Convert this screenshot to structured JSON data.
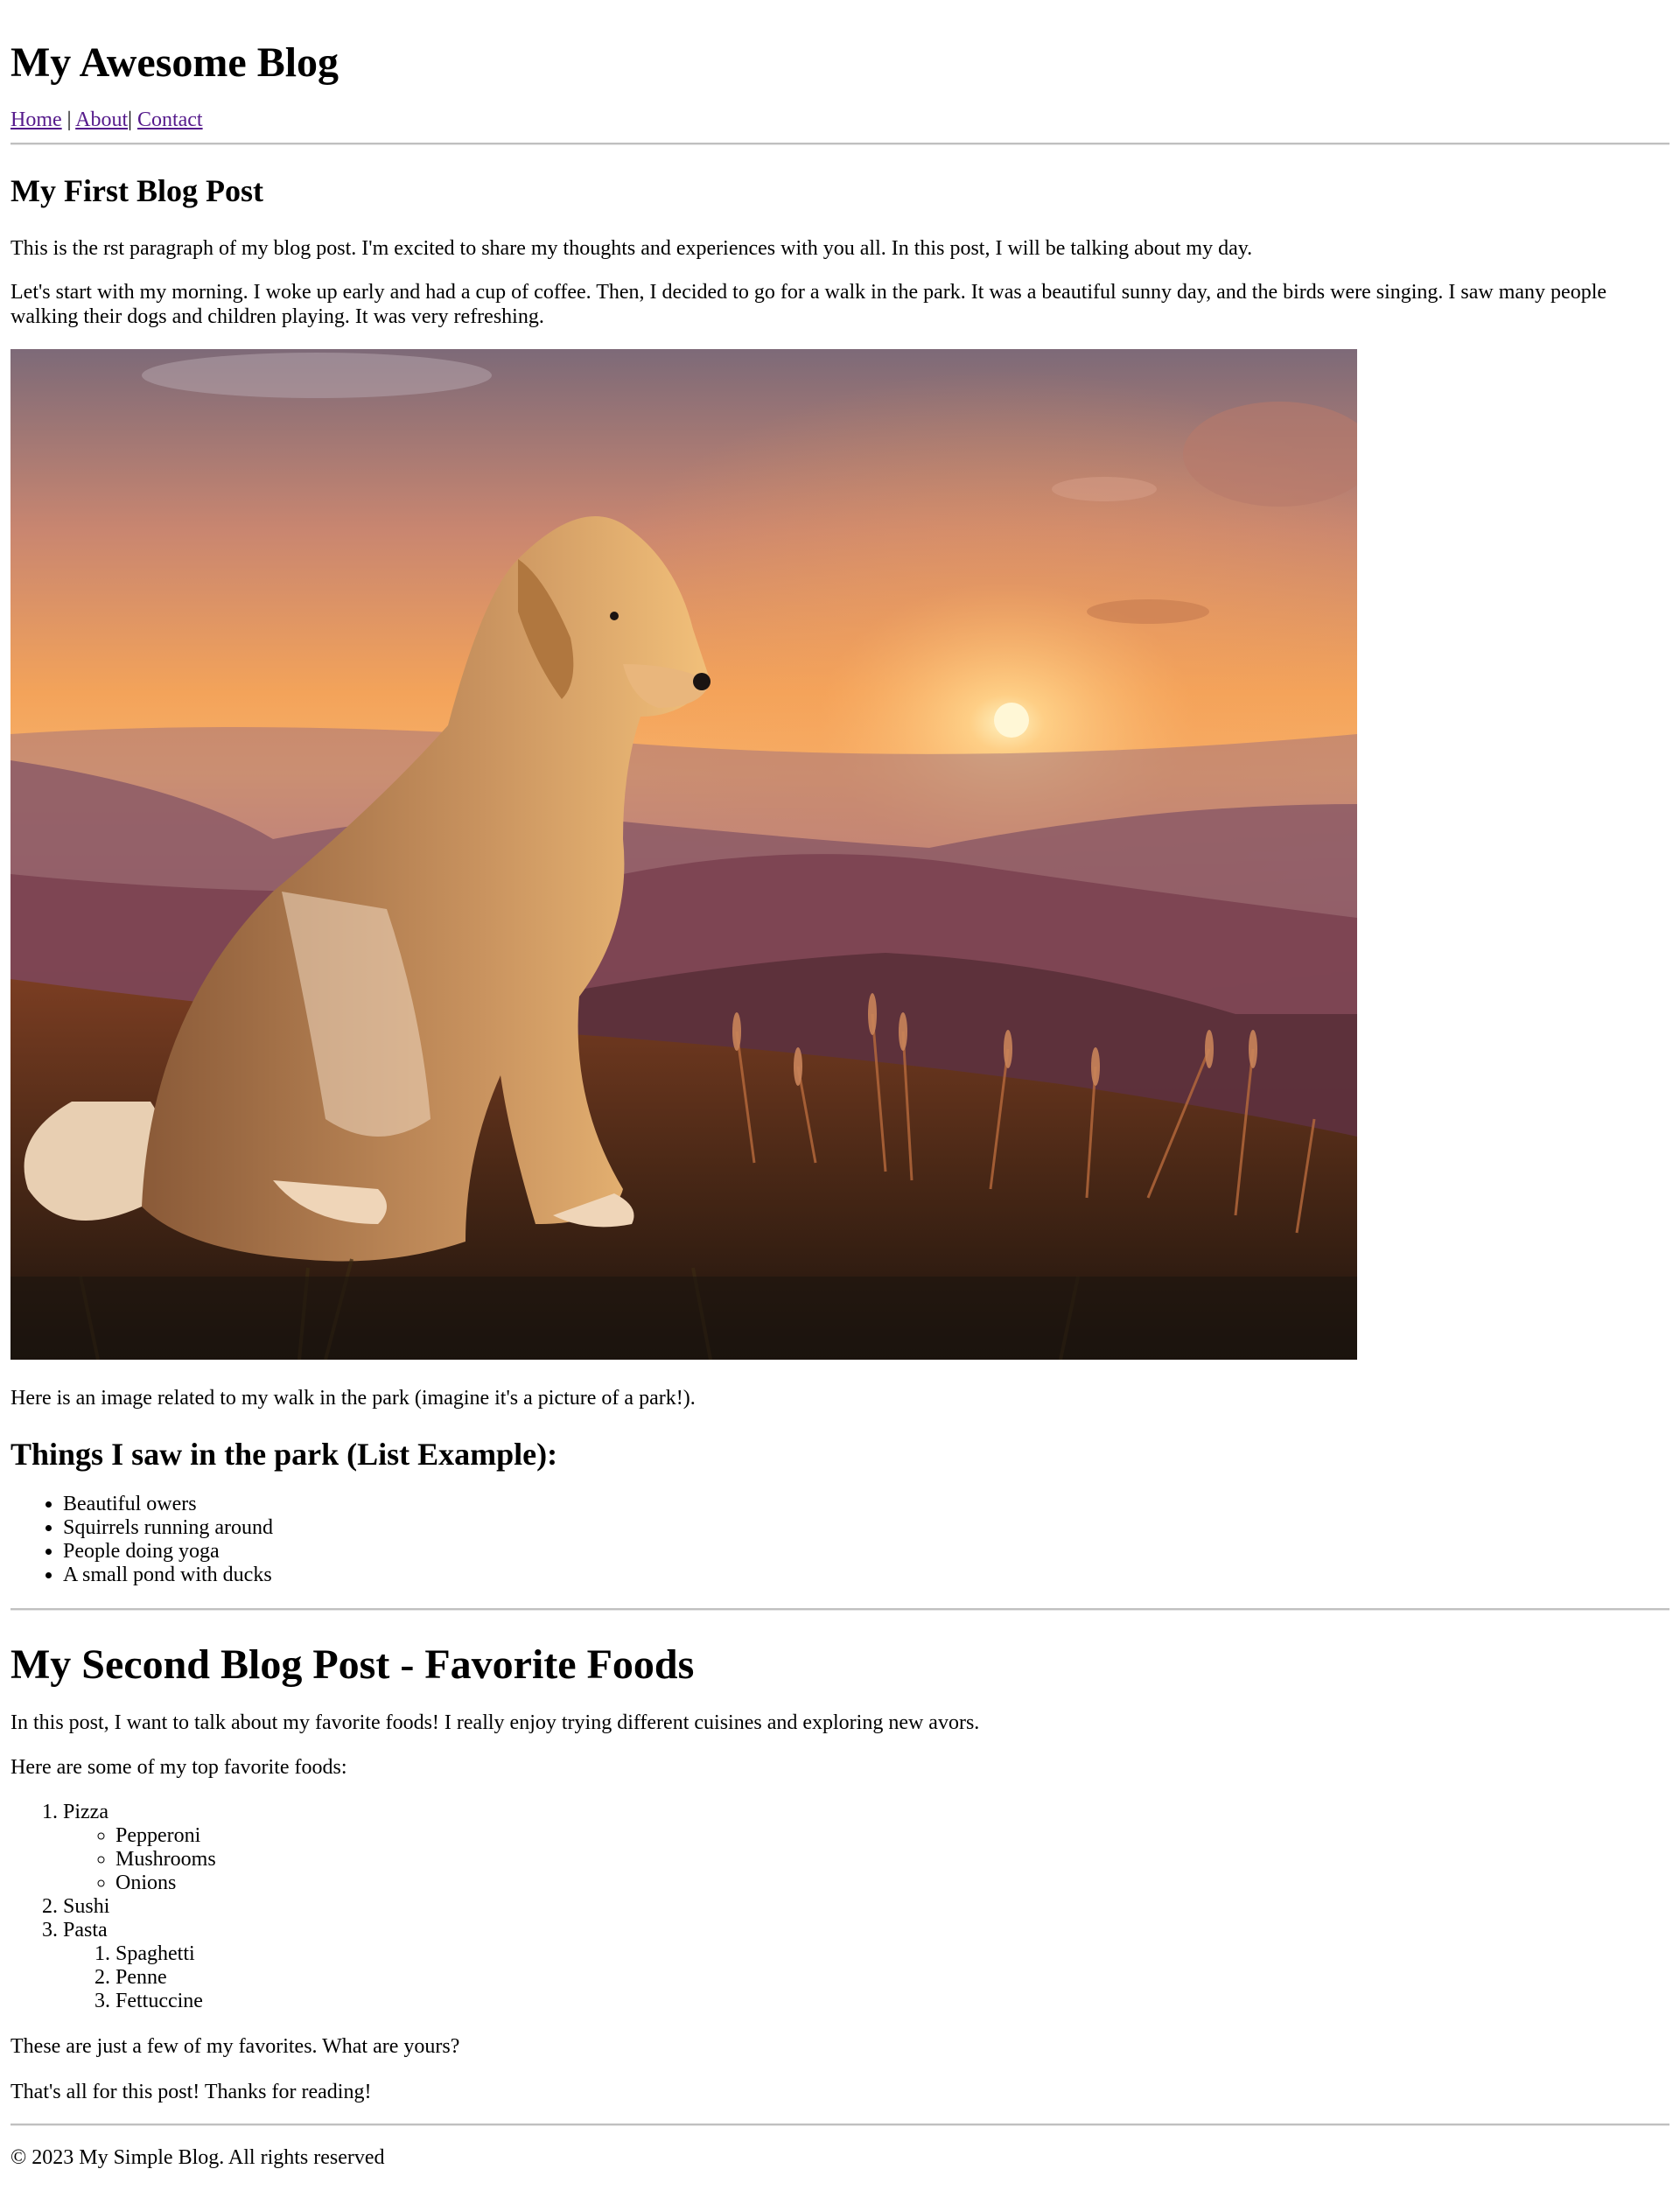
{
  "header": {
    "site_title": "My Awesome Blog",
    "nav": {
      "home": "Home",
      "sep1": " | ",
      "about": "About",
      "sep2": "| ",
      "contact": "Contact"
    }
  },
  "post1": {
    "title": "My First Blog Post",
    "paragraph1": "This is the rst paragraph of my blog post. I'm excited to share my thoughts and experiences with you all. In this post, I will be talking about my day.",
    "paragraph2": "Let's start with my morning. I woke up early and had a cup of coffee. Then, I decided to go for a walk in the park. It was a beautiful sunny day, and the birds were singing. I saw many people walking their dogs and children playing. It was very refreshing.",
    "image": {
      "subject": "golden dog sitting on grassy hill at sunset"
    },
    "caption": "Here is an image related to my walk in the park (imagine it's a picture of a park!).",
    "list_title": "Things I saw in the park (List Example):",
    "list_items": [
      "Beautiful owers",
      "Squirrels running around",
      "People doing yoga",
      "A small pond with ducks"
    ]
  },
  "post2": {
    "title": "My Second Blog Post - Favorite Foods",
    "paragraph1": "In this post, I want to talk about my favorite foods! I really enjoy trying different cuisines and exploring new avors.",
    "paragraph2": "Here are some of my top favorite foods:",
    "foods": [
      {
        "name": "Pizza",
        "sub": [
          "Pepperoni",
          "Mushrooms",
          "Onions"
        ]
      },
      {
        "name": "Sushi",
        "sub": []
      },
      {
        "name": "Pasta",
        "sub": [
          "Spaghetti",
          "Penne",
          "Fettuccine"
        ]
      }
    ],
    "paragraph3": "These are just a few of my favorites. What are yours?",
    "paragraph4": "That's all for this post! Thanks for reading!"
  },
  "footer": {
    "text": "© 2023 My Simple Blog. All rights reserved"
  },
  "colors": {
    "link_visited": "#551a8b",
    "rule": "#c0c0c0"
  }
}
